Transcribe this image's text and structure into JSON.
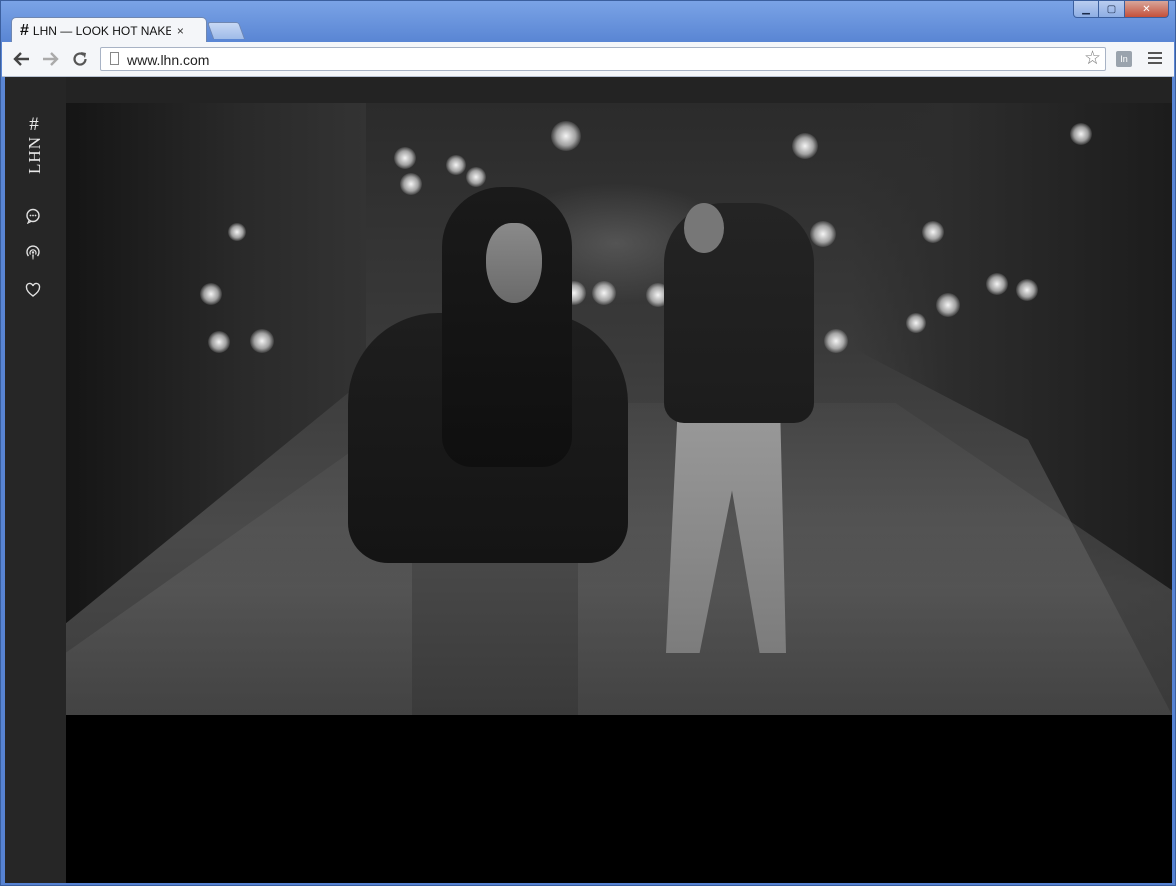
{
  "browser": {
    "tab_title": "LHN — LOOK HOT NAKED",
    "tab_icon": "#",
    "tab_close": "×",
    "url": "www.lhn.com",
    "window_controls": {
      "minimize": "▁",
      "maximize": "▢",
      "close": "✕"
    },
    "ext_badge": "In"
  },
  "sidebar": {
    "logo_hash": "#",
    "logo_text": "LHN",
    "icons": [
      "chat-icon",
      "podcast-icon",
      "heart-icon"
    ]
  },
  "colors": {
    "sidebar_bg": "#262626",
    "page_bg": "#000000",
    "icon_color": "#e0e0e0"
  }
}
